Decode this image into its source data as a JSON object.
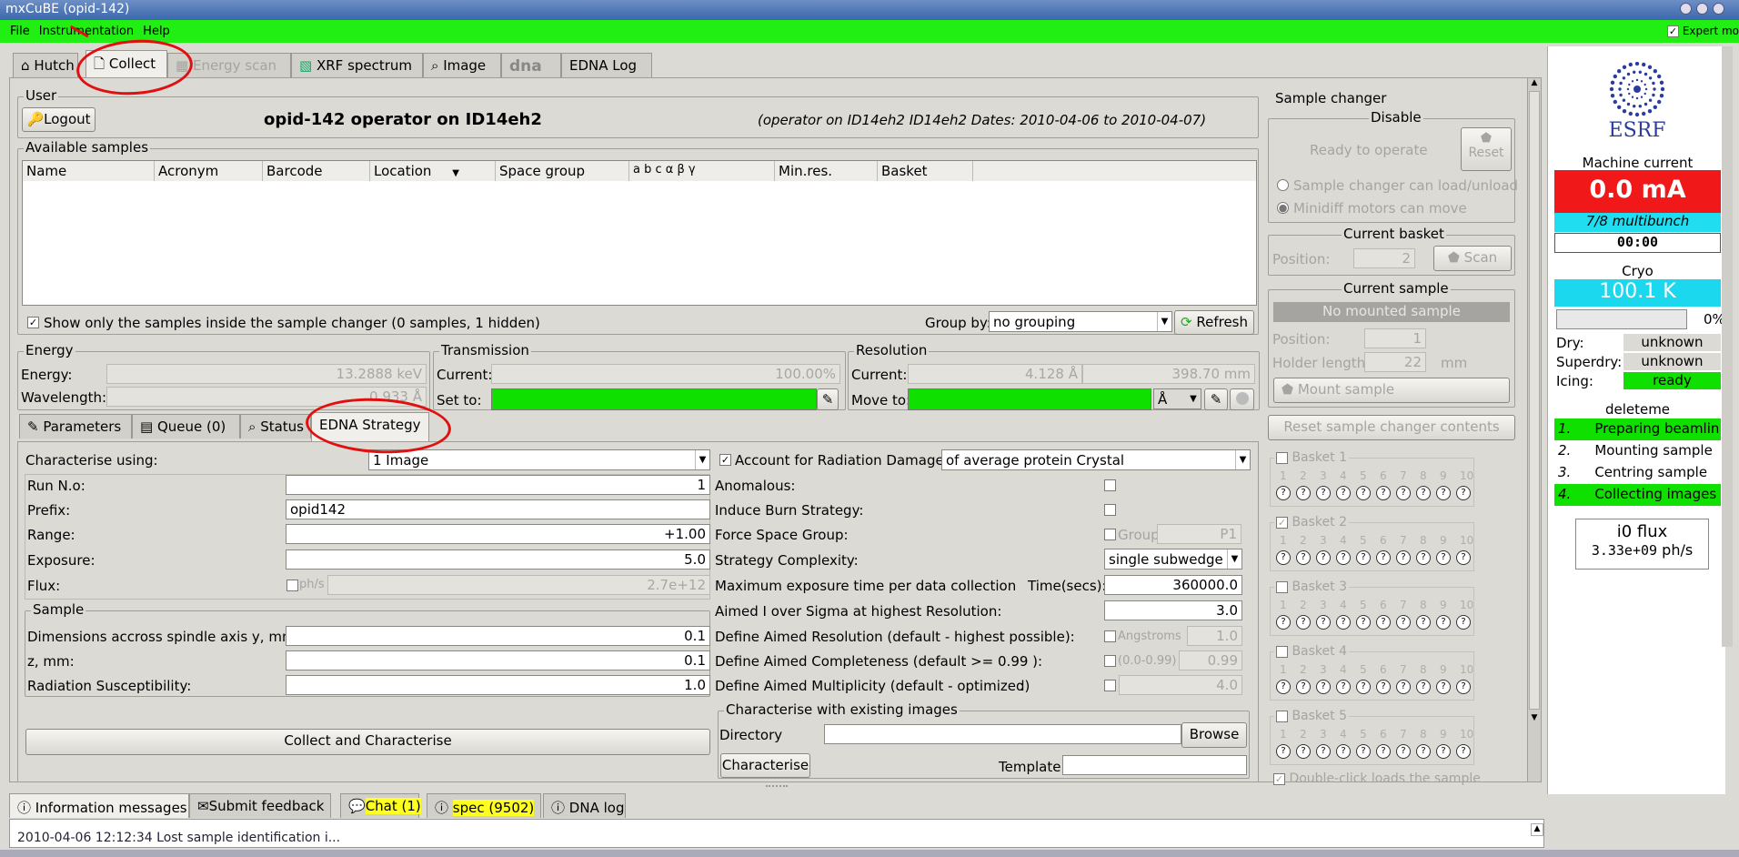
{
  "window": {
    "title": "mxCuBE (opid-142)"
  },
  "menu": {
    "file": "File",
    "instrumentation": "Instrumentation",
    "help": "Help",
    "expert": "Expert mo"
  },
  "tabs": [
    "Hutch",
    "Collect",
    "Energy scan",
    "XRF spectrum",
    "Image",
    "dna",
    "EDNA Log"
  ],
  "user": {
    "group": "User",
    "logout": "Logout",
    "operator": "opid-142 operator on ID14eh2",
    "info": "(operator on ID14eh2 ID14eh2 Dates: 2010-04-06 to 2010-04-07)"
  },
  "samples": {
    "group": "Available samples",
    "columns": [
      "Name",
      "Acronym",
      "Barcode",
      "Location",
      "Space group",
      "a  b  c  α  β  γ",
      "Min.res.",
      "Basket"
    ],
    "show_only": "Show only the samples inside the sample changer (0 samples, 1 hidden)",
    "group_by_label": "Group by:",
    "group_by_value": "no grouping",
    "refresh": "Refresh"
  },
  "energy": {
    "group": "Energy",
    "energy_label": "Energy:",
    "energy_value": "13.2888 keV",
    "wavelength_label": "Wavelength:",
    "wavelength_value": "0.933 Å"
  },
  "transmission": {
    "group": "Transmission",
    "current_label": "Current:",
    "current_value": "100.00%",
    "setto_label": "Set to:"
  },
  "resolution": {
    "group": "Resolution",
    "current_label": "Current:",
    "current_value": "4.128 Å",
    "current_value2": "398.70 mm",
    "moveto_label": "Move to:",
    "unit": "Å"
  },
  "subtabs": [
    "Parameters",
    "Queue (0)",
    "Status",
    "EDNA Strategy"
  ],
  "edna": {
    "characterise_label": "Characterise using:",
    "characterise_value": "1 Image",
    "run_label": "Run N.o:",
    "run_value": "1",
    "prefix_label": "Prefix:",
    "prefix_value": "opid142",
    "range_label": "Range:",
    "range_value": "+1.00",
    "exposure_label": "Exposure:",
    "exposure_value": "5.0",
    "flux_label": "Flux:",
    "flux_unit": "ph/s",
    "flux_value": "2.7e+12",
    "sample_group": "Sample",
    "dim_y_label": "Dimensions accross spindle axis y, mm:",
    "dim_y_value": "0.1",
    "z_label": "z, mm:",
    "z_value": "0.1",
    "rad_label": "Radiation Susceptibility:",
    "rad_value": "1.0",
    "collect_btn": "Collect and Characterise",
    "account_label": "Account for Radiation Damage:",
    "account_value": "of average protein Crystal",
    "anomalous_label": "Anomalous:",
    "burn_label": "Induce Burn Strategy:",
    "force_sg_label": "Force Space Group:",
    "group_label": "Group",
    "group_value": "P1",
    "complexity_label": "Strategy Complexity:",
    "complexity_value": "single subwedge",
    "maxexp_label": "Maximum exposure time per data collection",
    "time_label": "Time(secs):",
    "time_value": "360000.0",
    "aimed_label": "Aimed I over Sigma at highest Resolution:",
    "aimed_value": "3.0",
    "def_res_label": "Define Aimed Resolution (default - highest possible):",
    "angstroms": "Angstroms",
    "def_res_value": "1.0",
    "def_comp_label": "Define Aimed Completeness (default >= 0.99 ):",
    "comp_range": "(0.0-0.99)",
    "def_comp_value": "0.99",
    "def_mult_label": "Define Aimed Multiplicity (default - optimized)",
    "colon": ":",
    "def_mult_value": "4.0",
    "existing_group": "Characterise with existing images",
    "directory_label": "Directory",
    "browse": "Browse",
    "characterise_btn": "Characterise",
    "template_label": "Template"
  },
  "sample_changer": {
    "group": "Sample changer",
    "disable": "Disable",
    "ready": "Ready to operate",
    "reset": "Reset",
    "opt1": "Sample changer can load/unload",
    "opt2": "Minidiff motors can move",
    "current_basket": "Current basket",
    "position_label": "Position:",
    "basket_pos": "2",
    "scan": "Scan",
    "current_sample": "Current sample",
    "no_sample": "No mounted sample",
    "sample_pos": "1",
    "holder_label": "Holder length:",
    "holder_value": "22",
    "holder_unit": "mm",
    "mount": "Mount sample",
    "reset_contents": "Reset sample changer contents",
    "baskets": [
      "Basket 1",
      "Basket 2",
      "Basket 3",
      "Basket 4",
      "Basket 5"
    ],
    "double_click": "Double-click loads the sample"
  },
  "machine": {
    "title": "Machine current",
    "value": "0.0 mA",
    "mode": "7/8 multibunch",
    "clock": "00:00"
  },
  "cryo": {
    "title": "Cryo",
    "value": "100.1 K",
    "percent": "0%",
    "dry_label": "Dry:",
    "dry_value": "unknown",
    "superdry_label": "Superdry:",
    "superdry_value": "unknown",
    "icing_label": "Icing:",
    "icing_value": "ready"
  },
  "steps": {
    "title": "deleteme",
    "items": [
      {
        "n": "1.",
        "t": "Preparing beamlin"
      },
      {
        "n": "2.",
        "t": "Mounting sample"
      },
      {
        "n": "3.",
        "t": "Centring sample"
      },
      {
        "n": "4.",
        "t": "Collecting images"
      }
    ]
  },
  "flux": {
    "title": "i0 flux",
    "value": "3.33e+09",
    "unit": "ph/s"
  },
  "bottom_tabs": [
    "Information messages",
    "Submit feedback",
    "Chat (1)",
    "spec (9502)",
    "DNA log"
  ],
  "log_line": "2010-04-06 12:12:34 Lost sample identification i...",
  "logo": "ESRF"
}
